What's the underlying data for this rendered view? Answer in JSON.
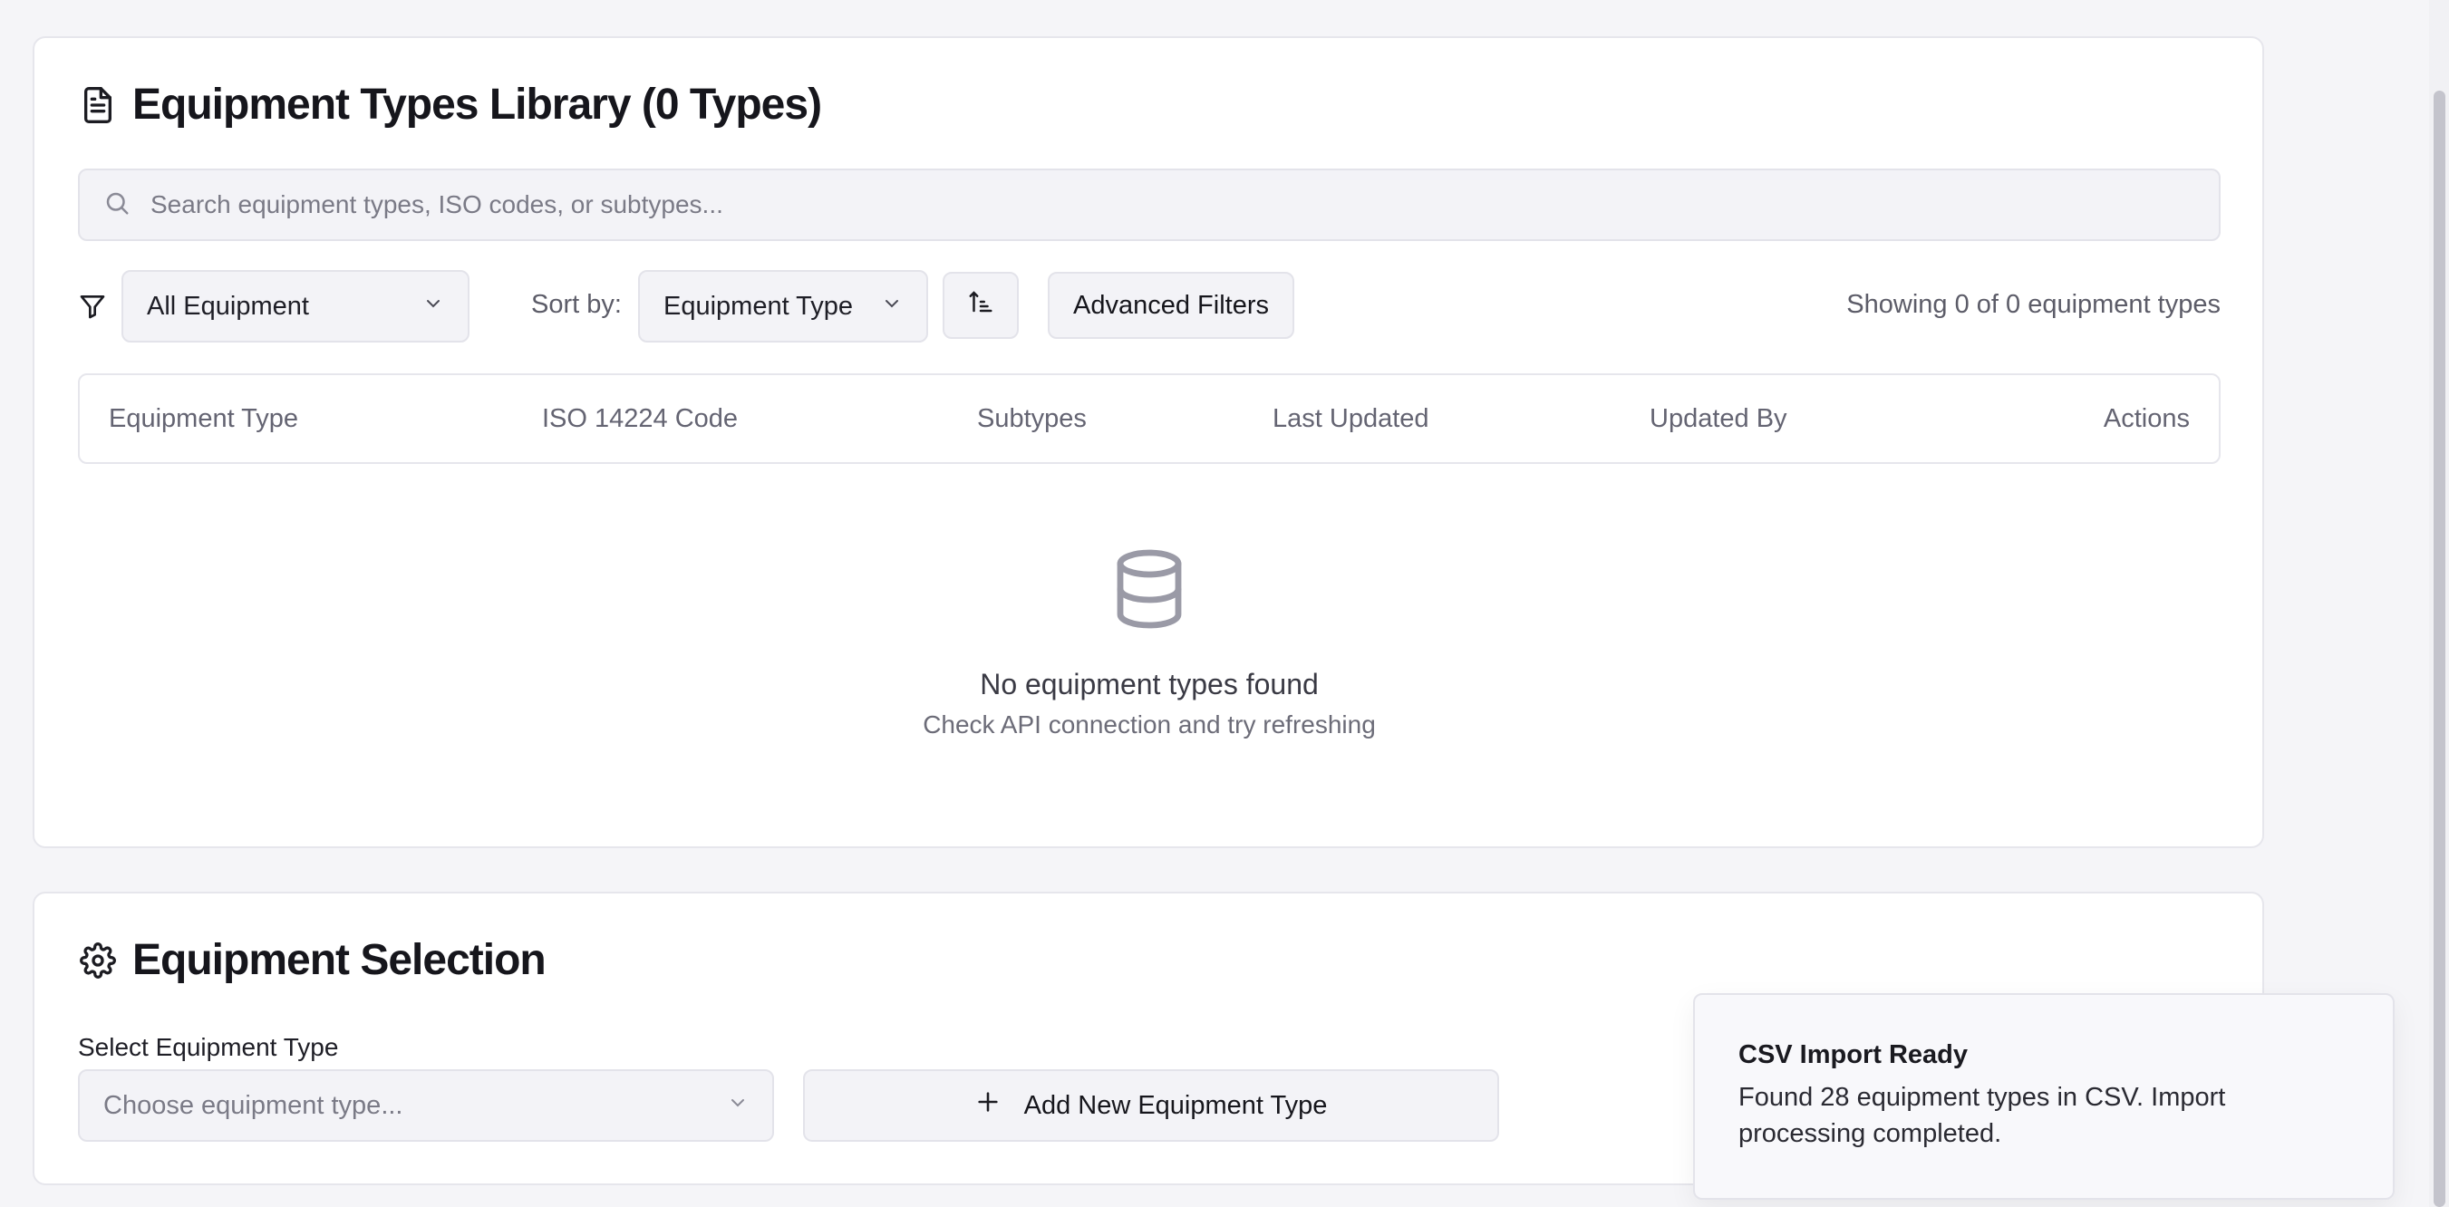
{
  "library": {
    "title": "Equipment Types Library (0 Types)",
    "title_icon": "document-icon",
    "search": {
      "placeholder": "Search equipment types, ISO codes, or subtypes...",
      "value": ""
    },
    "filter": {
      "icon": "funnel-icon",
      "selected": "All Equipment"
    },
    "sort": {
      "label": "Sort by:",
      "selected": "Equipment Type",
      "direction_icon": "sort-ascending-icon"
    },
    "advanced_filters_label": "Advanced Filters",
    "showing_text": "Showing 0 of 0 equipment types",
    "columns": [
      "Equipment Type",
      "ISO 14224 Code",
      "Subtypes",
      "Last Updated",
      "Updated By",
      "Actions"
    ],
    "empty": {
      "icon": "database-icon",
      "title": "No equipment types found",
      "subtitle": "Check API connection and try refreshing"
    }
  },
  "selection": {
    "title": "Equipment Selection",
    "title_icon": "gear-icon",
    "select_label": "Select Equipment Type",
    "select_placeholder": "Choose equipment type...",
    "add_button_label": "Add New Equipment Type"
  },
  "toast": {
    "title": "CSV Import Ready",
    "body": "Found 28 equipment types in CSV. Import processing completed."
  },
  "colors": {
    "background": "#f5f5f8",
    "card": "#ffffff",
    "input_bg": "#f3f3f7",
    "muted_text": "#646472",
    "icon_gray": "#9a9aa6"
  }
}
